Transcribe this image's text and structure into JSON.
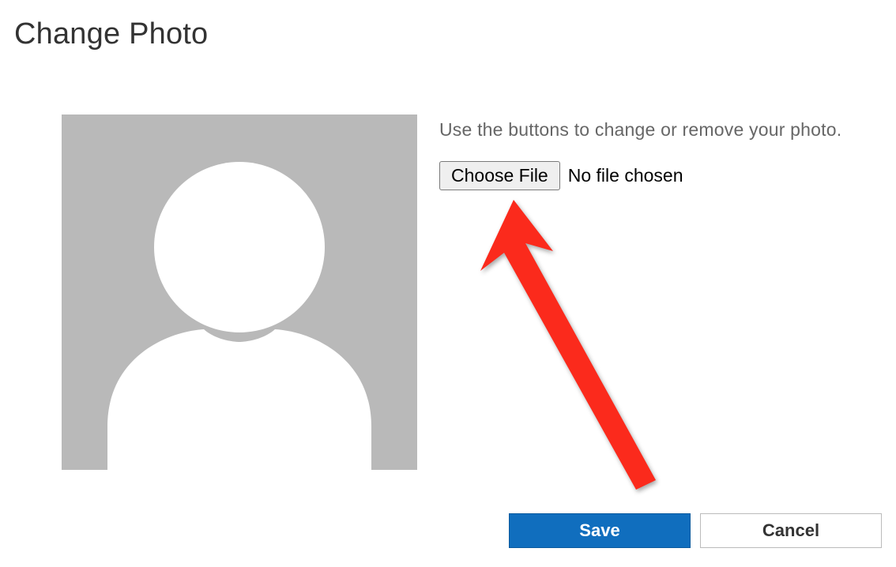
{
  "header": {
    "title": "Change Photo"
  },
  "instruction": "Use the buttons to change or remove your photo.",
  "fileInput": {
    "buttonLabel": "Choose File",
    "status": "No file chosen"
  },
  "actions": {
    "save": "Save",
    "cancel": "Cancel"
  },
  "colors": {
    "primary": "#106ebe",
    "avatarBg": "#b9b9b9",
    "annotation": "#fb2a1c"
  }
}
